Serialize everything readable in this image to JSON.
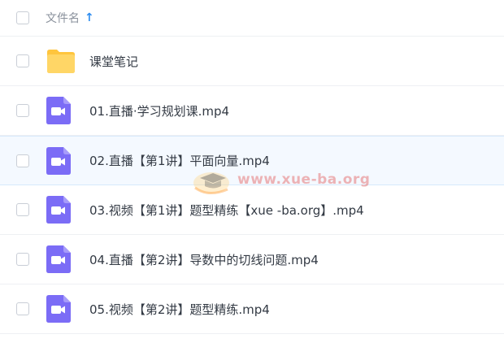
{
  "header": {
    "column_label": "文件名",
    "sort_icon": "arrow-up-icon",
    "accent_color": "#2d8cf0"
  },
  "files": [
    {
      "name": "课堂笔记",
      "type": "folder",
      "icon": "folder-icon"
    },
    {
      "name": "01.直播·学习规划课.mp4",
      "type": "video",
      "icon": "video-icon"
    },
    {
      "name": "02.直播【第1讲】平面向量.mp4",
      "type": "video",
      "icon": "video-icon"
    },
    {
      "name": "03.视频【第1讲】题型精练【xue -ba.org】.mp4",
      "type": "video",
      "icon": "video-icon"
    },
    {
      "name": "04.直播【第2讲】导数中的切线问题.mp4",
      "type": "video",
      "icon": "video-icon"
    },
    {
      "name": "05.视频【第2讲】题型精练.mp4",
      "type": "video",
      "icon": "video-icon"
    }
  ],
  "watermark": {
    "text": "www.xue-ba.org"
  },
  "colors": {
    "folder": "#ffd257",
    "video": "#7b6cf6",
    "row_highlight": "#f4f9ff"
  }
}
